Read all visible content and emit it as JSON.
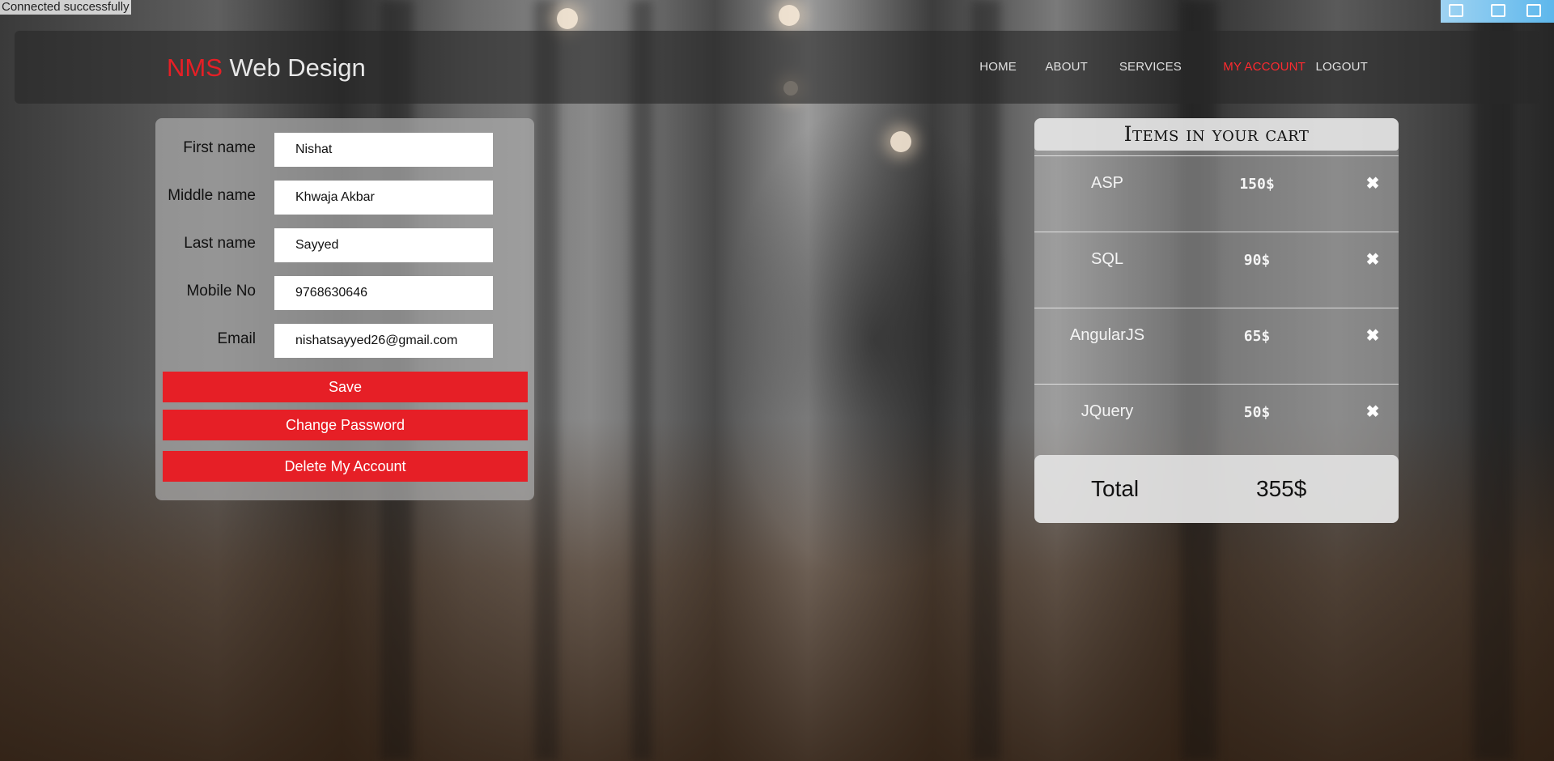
{
  "status": {
    "text": "Connected successfully"
  },
  "brand": {
    "accent": "NMS",
    "rest": " Web Design"
  },
  "nav": {
    "items": [
      {
        "label": "HOME"
      },
      {
        "label": "ABOUT"
      },
      {
        "label": "SERVICES"
      },
      {
        "label": "MY ACCOUNT",
        "active": true
      },
      {
        "label": "LOGOUT"
      }
    ]
  },
  "profile": {
    "fields": [
      {
        "label": "First name",
        "value": "Nishat"
      },
      {
        "label": "Middle name",
        "value": "Khwaja Akbar"
      },
      {
        "label": "Last name",
        "value": "Sayyed"
      },
      {
        "label": "Mobile No",
        "value": "9768630646"
      },
      {
        "label": "Email",
        "value": "nishatsayyed26@gmail.com"
      }
    ],
    "buttons": {
      "save": "Save",
      "change_password": "Change Password",
      "delete_account": "Delete My Account"
    }
  },
  "cart": {
    "title": "Items in your cart",
    "items": [
      {
        "name": "ASP",
        "price": "150$"
      },
      {
        "name": "SQL",
        "price": "90$"
      },
      {
        "name": "AngularJS",
        "price": "65$"
      },
      {
        "name": "JQuery",
        "price": "50$"
      }
    ],
    "remove_icon": "close-icon",
    "total_label": "Total",
    "total_value": "355$"
  },
  "colors": {
    "accent": "#e61f26",
    "active_nav": "#ff2a2f"
  }
}
